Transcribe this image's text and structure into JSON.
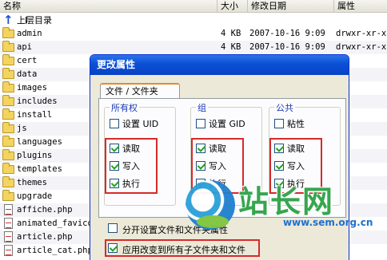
{
  "columns": {
    "name": "名称",
    "size": "大小",
    "date": "修改日期",
    "attr": "属性"
  },
  "parent_dir_label": "上层目录",
  "files": [
    {
      "name": "admin",
      "type": "folder",
      "size": "4 KB",
      "date": "2007-10-16 9:09",
      "attr": "drwxr-xr-x"
    },
    {
      "name": "api",
      "type": "folder",
      "size": "4 KB",
      "date": "2007-10-16 9:09",
      "attr": "drwxr-xr-x"
    },
    {
      "name": "cert",
      "type": "folder",
      "size": "",
      "date": "",
      "attr": ""
    },
    {
      "name": "data",
      "type": "folder",
      "size": "",
      "date": "",
      "attr": ""
    },
    {
      "name": "images",
      "type": "folder",
      "size": "",
      "date": "",
      "attr": ""
    },
    {
      "name": "includes",
      "type": "folder",
      "size": "",
      "date": "",
      "attr": ""
    },
    {
      "name": "install",
      "type": "folder",
      "size": "",
      "date": "",
      "attr": ""
    },
    {
      "name": "js",
      "type": "folder",
      "size": "",
      "date": "",
      "attr": ""
    },
    {
      "name": "languages",
      "type": "folder",
      "size": "",
      "date": "",
      "attr": ""
    },
    {
      "name": "plugins",
      "type": "folder",
      "size": "",
      "date": "",
      "attr": ""
    },
    {
      "name": "templates",
      "type": "folder",
      "size": "",
      "date": "",
      "attr": ""
    },
    {
      "name": "themes",
      "type": "folder",
      "size": "",
      "date": "",
      "attr": ""
    },
    {
      "name": "upgrade",
      "type": "folder",
      "size": "",
      "date": "",
      "attr": ""
    },
    {
      "name": "affiche.php",
      "type": "file",
      "size": "",
      "date": "",
      "attr": ""
    },
    {
      "name": "animated_favicon",
      "type": "file",
      "size": "",
      "date": "",
      "attr": ""
    },
    {
      "name": "article.php",
      "type": "file",
      "size": "",
      "date": "",
      "attr": ""
    },
    {
      "name": "article_cat.php",
      "type": "file",
      "size": "",
      "date": "",
      "attr": ""
    }
  ],
  "dialog": {
    "title": "更改属性",
    "tab_label": "文件 / 文件夹",
    "groups": [
      {
        "title": "所有权",
        "special_label": "设置 UID",
        "special_checked": false,
        "read": "读取",
        "write": "写入",
        "exec": "执行",
        "read_checked": true,
        "write_checked": true,
        "exec_checked": true
      },
      {
        "title": "组",
        "special_label": "设置 GID",
        "special_checked": false,
        "read": "读取",
        "write": "写入",
        "exec": "执行",
        "read_checked": true,
        "write_checked": true,
        "exec_checked": true
      },
      {
        "title": "公共",
        "special_label": "粘性",
        "special_checked": false,
        "read": "读取",
        "write": "写入",
        "exec": "执行",
        "read_checked": true,
        "write_checked": true,
        "exec_checked": true
      }
    ],
    "option_separate": "分开设置文件和文件夹属性",
    "option_separate_checked": false,
    "option_recursive": "应用改变到所有子文件夹和文件",
    "option_recursive_checked": true
  },
  "watermark": {
    "text": "站长网",
    "url": "www.sem.org.cn"
  },
  "colors": {
    "accent_red": "#d62a2a",
    "title_blue": "#0a4fd6",
    "folder_yellow": "#f4d35e"
  }
}
